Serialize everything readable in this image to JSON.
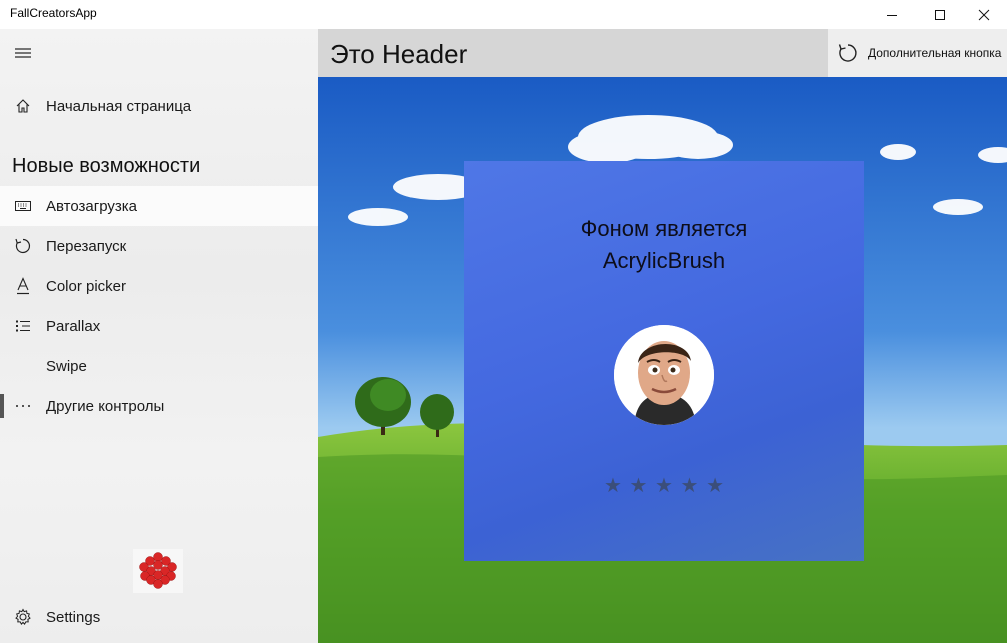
{
  "window": {
    "title": "FallCreatorsApp"
  },
  "sidebar": {
    "home_label": "Начальная страница",
    "section_title": "Новые возможности",
    "items": [
      {
        "label": "Автозагрузка",
        "icon": "keyboard-icon"
      },
      {
        "label": "Перезапуск",
        "icon": "restart-icon"
      },
      {
        "label": "Color picker",
        "icon": "font-color-icon"
      },
      {
        "label": "Parallax",
        "icon": "bullet-list-icon"
      },
      {
        "label": "Swipe",
        "icon": "swipe-icon"
      },
      {
        "label": "Другие контролы",
        "icon": "more-icon"
      }
    ],
    "settings_label": "Settings",
    "selected_index": 5
  },
  "header": {
    "title": "Это Header",
    "extra_button_label": "Дополнительная кнопка"
  },
  "card": {
    "title_line1": "Фоном является",
    "title_line2": "AcrylicBrush",
    "rating": {
      "max": 5,
      "value": 0,
      "star_glyph": "★"
    }
  },
  "colors": {
    "accent_card": "#4469e0",
    "header_bg": "#d6d6d6",
    "sidebar_bg": "#f0f0f0"
  }
}
